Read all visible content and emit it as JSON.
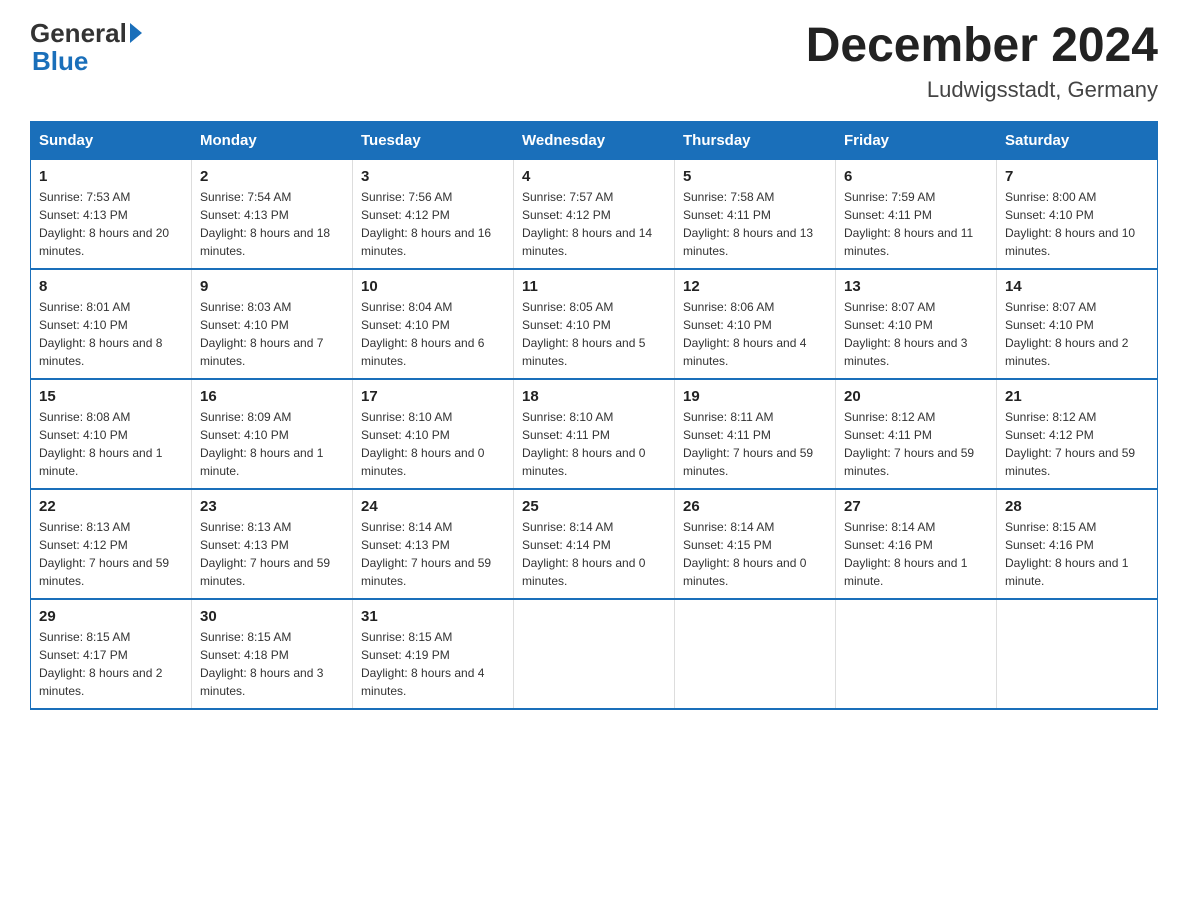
{
  "logo": {
    "general": "General",
    "blue": "Blue"
  },
  "title": "December 2024",
  "subtitle": "Ludwigsstadt, Germany",
  "days_of_week": [
    "Sunday",
    "Monday",
    "Tuesday",
    "Wednesday",
    "Thursday",
    "Friday",
    "Saturday"
  ],
  "weeks": [
    [
      {
        "day": "1",
        "sunrise": "7:53 AM",
        "sunset": "4:13 PM",
        "daylight": "8 hours and 20 minutes."
      },
      {
        "day": "2",
        "sunrise": "7:54 AM",
        "sunset": "4:13 PM",
        "daylight": "8 hours and 18 minutes."
      },
      {
        "day": "3",
        "sunrise": "7:56 AM",
        "sunset": "4:12 PM",
        "daylight": "8 hours and 16 minutes."
      },
      {
        "day": "4",
        "sunrise": "7:57 AM",
        "sunset": "4:12 PM",
        "daylight": "8 hours and 14 minutes."
      },
      {
        "day": "5",
        "sunrise": "7:58 AM",
        "sunset": "4:11 PM",
        "daylight": "8 hours and 13 minutes."
      },
      {
        "day": "6",
        "sunrise": "7:59 AM",
        "sunset": "4:11 PM",
        "daylight": "8 hours and 11 minutes."
      },
      {
        "day": "7",
        "sunrise": "8:00 AM",
        "sunset": "4:10 PM",
        "daylight": "8 hours and 10 minutes."
      }
    ],
    [
      {
        "day": "8",
        "sunrise": "8:01 AM",
        "sunset": "4:10 PM",
        "daylight": "8 hours and 8 minutes."
      },
      {
        "day": "9",
        "sunrise": "8:03 AM",
        "sunset": "4:10 PM",
        "daylight": "8 hours and 7 minutes."
      },
      {
        "day": "10",
        "sunrise": "8:04 AM",
        "sunset": "4:10 PM",
        "daylight": "8 hours and 6 minutes."
      },
      {
        "day": "11",
        "sunrise": "8:05 AM",
        "sunset": "4:10 PM",
        "daylight": "8 hours and 5 minutes."
      },
      {
        "day": "12",
        "sunrise": "8:06 AM",
        "sunset": "4:10 PM",
        "daylight": "8 hours and 4 minutes."
      },
      {
        "day": "13",
        "sunrise": "8:07 AM",
        "sunset": "4:10 PM",
        "daylight": "8 hours and 3 minutes."
      },
      {
        "day": "14",
        "sunrise": "8:07 AM",
        "sunset": "4:10 PM",
        "daylight": "8 hours and 2 minutes."
      }
    ],
    [
      {
        "day": "15",
        "sunrise": "8:08 AM",
        "sunset": "4:10 PM",
        "daylight": "8 hours and 1 minute."
      },
      {
        "day": "16",
        "sunrise": "8:09 AM",
        "sunset": "4:10 PM",
        "daylight": "8 hours and 1 minute."
      },
      {
        "day": "17",
        "sunrise": "8:10 AM",
        "sunset": "4:10 PM",
        "daylight": "8 hours and 0 minutes."
      },
      {
        "day": "18",
        "sunrise": "8:10 AM",
        "sunset": "4:11 PM",
        "daylight": "8 hours and 0 minutes."
      },
      {
        "day": "19",
        "sunrise": "8:11 AM",
        "sunset": "4:11 PM",
        "daylight": "7 hours and 59 minutes."
      },
      {
        "day": "20",
        "sunrise": "8:12 AM",
        "sunset": "4:11 PM",
        "daylight": "7 hours and 59 minutes."
      },
      {
        "day": "21",
        "sunrise": "8:12 AM",
        "sunset": "4:12 PM",
        "daylight": "7 hours and 59 minutes."
      }
    ],
    [
      {
        "day": "22",
        "sunrise": "8:13 AM",
        "sunset": "4:12 PM",
        "daylight": "7 hours and 59 minutes."
      },
      {
        "day": "23",
        "sunrise": "8:13 AM",
        "sunset": "4:13 PM",
        "daylight": "7 hours and 59 minutes."
      },
      {
        "day": "24",
        "sunrise": "8:14 AM",
        "sunset": "4:13 PM",
        "daylight": "7 hours and 59 minutes."
      },
      {
        "day": "25",
        "sunrise": "8:14 AM",
        "sunset": "4:14 PM",
        "daylight": "8 hours and 0 minutes."
      },
      {
        "day": "26",
        "sunrise": "8:14 AM",
        "sunset": "4:15 PM",
        "daylight": "8 hours and 0 minutes."
      },
      {
        "day": "27",
        "sunrise": "8:14 AM",
        "sunset": "4:16 PM",
        "daylight": "8 hours and 1 minute."
      },
      {
        "day": "28",
        "sunrise": "8:15 AM",
        "sunset": "4:16 PM",
        "daylight": "8 hours and 1 minute."
      }
    ],
    [
      {
        "day": "29",
        "sunrise": "8:15 AM",
        "sunset": "4:17 PM",
        "daylight": "8 hours and 2 minutes."
      },
      {
        "day": "30",
        "sunrise": "8:15 AM",
        "sunset": "4:18 PM",
        "daylight": "8 hours and 3 minutes."
      },
      {
        "day": "31",
        "sunrise": "8:15 AM",
        "sunset": "4:19 PM",
        "daylight": "8 hours and 4 minutes."
      },
      null,
      null,
      null,
      null
    ]
  ]
}
